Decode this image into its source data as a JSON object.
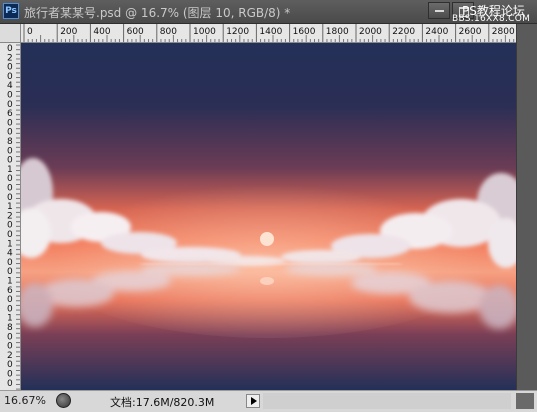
{
  "window": {
    "title": "旅行者某某号.psd @ 16.7% (图层 10, RGB/8) *",
    "app_icon_text": "Ps",
    "watermark": {
      "line1": "PS教程论坛",
      "line2": "BBS.16XX8.COM"
    }
  },
  "ruler_h": {
    "labels": [
      "0",
      "200",
      "400",
      "600",
      "800",
      "1000",
      "1200",
      "1400",
      "1600",
      "1800",
      "2000",
      "2200",
      "2400",
      "2600",
      "2800"
    ]
  },
  "ruler_v": {
    "chars": [
      "0",
      "2",
      "0",
      "0",
      "4",
      "0",
      "0",
      "6",
      "0",
      "0",
      "8",
      "0",
      "0",
      "1",
      "0",
      "0",
      "0",
      "1",
      "2",
      "0",
      "0",
      "1",
      "4",
      "0",
      "0",
      "1",
      "6",
      "0",
      "0",
      "1",
      "8",
      "0",
      "0",
      "2",
      "0",
      "0",
      "0"
    ]
  },
  "canvas": {
    "image": "sunset-clouds-reflection",
    "colors": {
      "sky_top": "#233058",
      "glow": "#f27b5b",
      "horizon": "#f6a183",
      "cloud": "#f3eef0",
      "cloud_shadow": "#b9a8b8"
    }
  },
  "statusbar": {
    "zoom": "16.67%",
    "doc_info": "文档:17.6M/820.3M"
  }
}
